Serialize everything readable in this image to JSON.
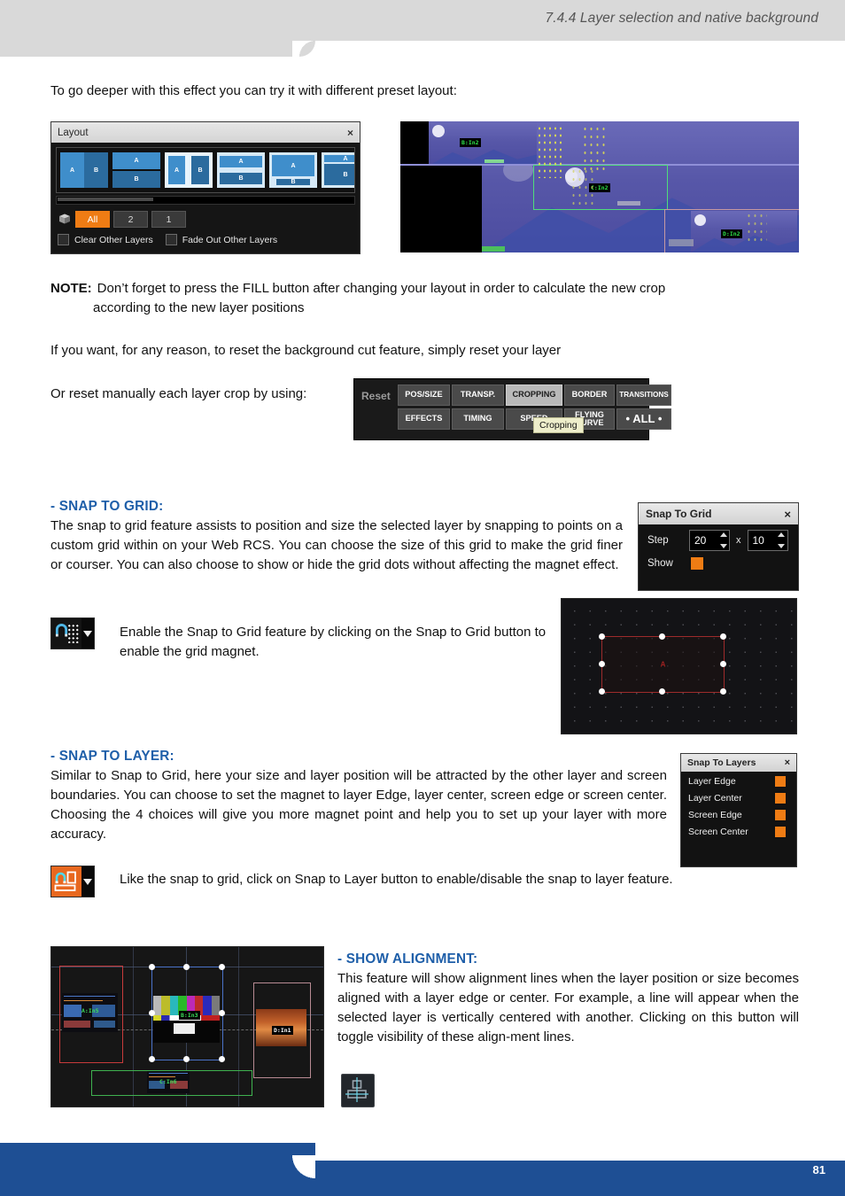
{
  "header": {
    "title": "7.4.4 Layer selection and native background"
  },
  "footer": {
    "page_number": "81"
  },
  "intro": {
    "text": "To go deeper with this effect you can try it with different preset layout:"
  },
  "layout_panel": {
    "title": "Layout",
    "close": "×",
    "presets": [
      {
        "a": "A",
        "b": "B"
      },
      {
        "a": "A",
        "b": "B"
      },
      {
        "a": "A",
        "b": "B"
      },
      {
        "a": "A",
        "b": "B"
      },
      {
        "a": "A",
        "b": "B"
      },
      {
        "a": "A",
        "b": "B"
      }
    ],
    "segments": [
      {
        "label": "All",
        "selected": true
      },
      {
        "label": "2",
        "selected": false
      },
      {
        "label": "1",
        "selected": false
      }
    ],
    "checkboxes": [
      {
        "label": "Clear Other Layers",
        "checked": false
      },
      {
        "label": "Fade Out Other Layers",
        "checked": false
      }
    ]
  },
  "preview_top": {
    "layer_labels": [
      "B:In2",
      "C:In2",
      "D:In2"
    ]
  },
  "note": {
    "prefix": "NOTE:",
    "line1": "Don’t forget to press the FILL button after changing your layout in order to calculate the new crop",
    "line2": "according to the new layer positions"
  },
  "reset_intro": "If you want, for any reason, to reset the background cut feature, simply reset your layer",
  "reset_caption": "Or reset manually each layer crop by using:",
  "reset_panel": {
    "label": "Reset",
    "buttons_row1": [
      {
        "label": "POS/SIZE",
        "highlighted": false
      },
      {
        "label": "TRANSP.",
        "highlighted": false
      },
      {
        "label": "CROPPING",
        "highlighted": true
      },
      {
        "label": "BORDER",
        "highlighted": false
      },
      {
        "label": "TRANSITIONS",
        "highlighted": false
      }
    ],
    "buttons_row2": [
      {
        "label": "EFFECTS",
        "highlighted": false
      },
      {
        "label": "TIMING",
        "highlighted": false
      },
      {
        "label": "SPEED",
        "highlighted": false
      },
      {
        "label": "FLYING CURVE",
        "highlighted": false
      },
      {
        "label": "• ALL •",
        "highlighted": false
      }
    ],
    "tooltip": "Cropping"
  },
  "snap_to_grid_section": {
    "heading": "- SNAP TO GRID:",
    "body": "The snap to grid feature assists to position and size the selected layer by snapping to points on a custom grid within on your Web RCS. You can choose the size of this grid to make the grid finer or courser. You can also choose to show or hide the grid dots without affecting the magnet effect.",
    "caption": "Enable the Snap to Grid feature by clicking on the Snap to Grid button to enable the grid magnet."
  },
  "snap_to_grid_panel": {
    "title": "Snap To Grid",
    "close": "×",
    "step_label": "Step",
    "step_x": "20",
    "separator": "x",
    "step_y": "10",
    "show_label": "Show",
    "show_checked": true
  },
  "grid_preview": {
    "layer_label": "A"
  },
  "snap_to_layer_section": {
    "heading": "- SNAP TO LAYER:",
    "body": "Similar to Snap to Grid, here your size and layer position will be attracted by the other layer and screen boundaries. You can choose to set the magnet to layer Edge, layer center, screen edge or screen center.  Choosing the 4 choices will give you more magnet point and help you to set up your layer with more accuracy.",
    "caption": "Like the snap to grid, click on Snap to Layer button to enable/disable the snap to layer feature."
  },
  "snap_to_layers_panel": {
    "title": "Snap To Layers",
    "close": "×",
    "options": [
      {
        "label": "Layer Edge",
        "checked": true
      },
      {
        "label": "Layer Center",
        "checked": true
      },
      {
        "label": "Screen Edge",
        "checked": true
      },
      {
        "label": "Screen Center",
        "checked": true
      }
    ]
  },
  "show_alignment_section": {
    "heading": "- SHOW ALIGNMENT:",
    "body": "This feature will show alignment lines when the layer position or size becomes aligned with a layer edge or center. For example, a line will appear when the selected layer is vertically centered with another. Clicking on this button will toggle visibility of these align-ment lines."
  },
  "alignment_preview": {
    "layer_labels": [
      "A:In5",
      "B:In3",
      "C:In6",
      "D:In1"
    ]
  },
  "colors": {
    "accent_blue": "#1f5fa9",
    "footer_blue": "#1e4f94",
    "orange": "#ef7c14",
    "header_gray": "#d9d9d9"
  }
}
